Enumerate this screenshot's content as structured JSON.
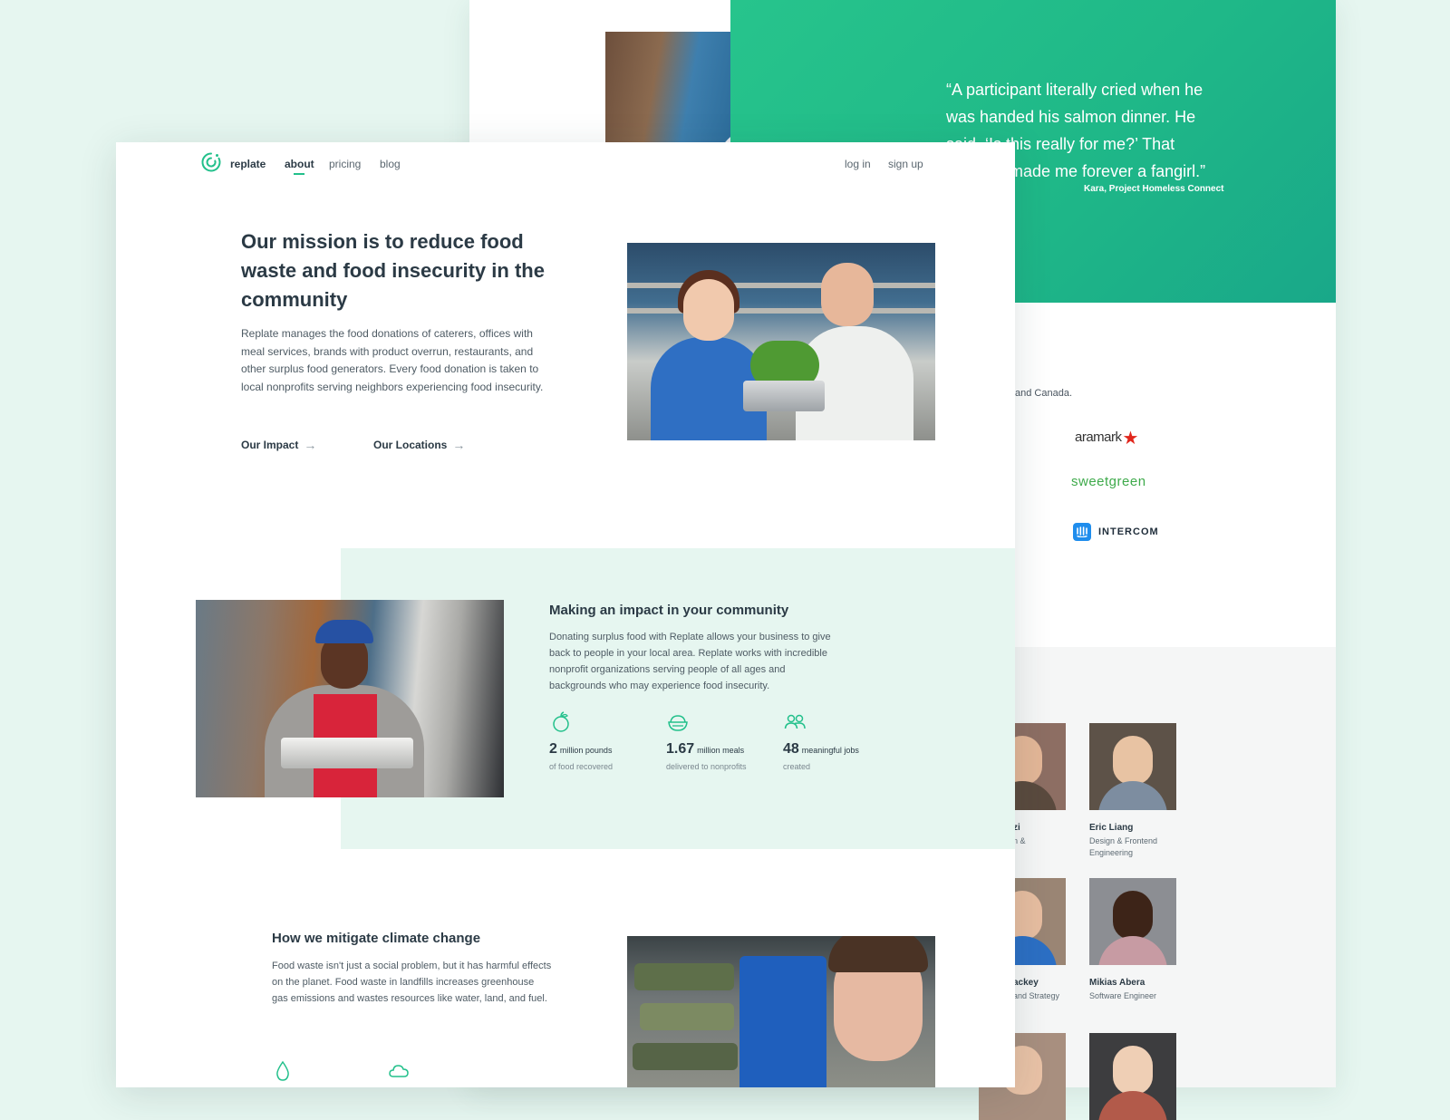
{
  "back_page": {
    "quote": {
      "text": "“A participant literally cried when he was handed his salmon dinner. He said, ‘Is this really for me?’ That moment made me forever a fangirl.”",
      "author": "Kara, Project Homeless Connect"
    },
    "partners": {
      "caption": "and Canada.",
      "logos": [
        "aramark",
        "sweetgreen",
        "INTERCOM"
      ]
    },
    "team": [
      {
        "name": "Eric Liang",
        "role": "Design & Frontend Engineering"
      },
      {
        "name": "Mikias Abera",
        "role": "Software Engineer"
      },
      {
        "name_partial": "zi",
        "role_partial": "n &"
      },
      {
        "name_partial": "ackey",
        "role_partial": "and Strategy"
      }
    ]
  },
  "nav": {
    "brand": "replate",
    "links": [
      "about",
      "pricing",
      "blog"
    ],
    "active": "about",
    "login": "log in",
    "signup": "sign up"
  },
  "hero": {
    "title": "Our mission is to reduce food waste and food insecurity in the community",
    "body": "Replate manages the food donations of caterers, offices with meal services, brands with product overrun, restaurants, and other surplus food generators. Every food donation is taken to local nonprofits serving neighbors experiencing food insecurity.",
    "links": [
      {
        "label": "Our Impact",
        "arrow": "→"
      },
      {
        "label": "Our Locations",
        "arrow": "→"
      }
    ]
  },
  "impact": {
    "title": "Making an impact in your community",
    "body": "Donating surplus food with Replate allows your business to give back to people in your local area. Replate works with incredible nonprofit organizations serving people of all ages and backgrounds who may experience food insecurity.",
    "stats": [
      {
        "icon": "apple-icon",
        "number": "2",
        "unit": "million pounds",
        "desc": "of food recovered"
      },
      {
        "icon": "bowl-icon",
        "number": "1.67",
        "unit": "million meals",
        "desc": "delivered to nonprofits"
      },
      {
        "icon": "people-icon",
        "number": "48",
        "unit": "meaningful jobs",
        "desc": "created"
      }
    ]
  },
  "climate": {
    "title": "How we mitigate climate change",
    "body": "Food waste isn't just a social problem, but it has harmful effects on the planet. Food waste in landfills increases greenhouse gas emissions and wastes resources like water, land, and fuel.",
    "icons": [
      "water-drop-icon",
      "cloud-icon"
    ]
  },
  "colors": {
    "brand_green": "#22c08b",
    "quote_panel": "#1fb888",
    "mint_background": "#e6f6f0",
    "text_dark": "#2b3a45"
  }
}
